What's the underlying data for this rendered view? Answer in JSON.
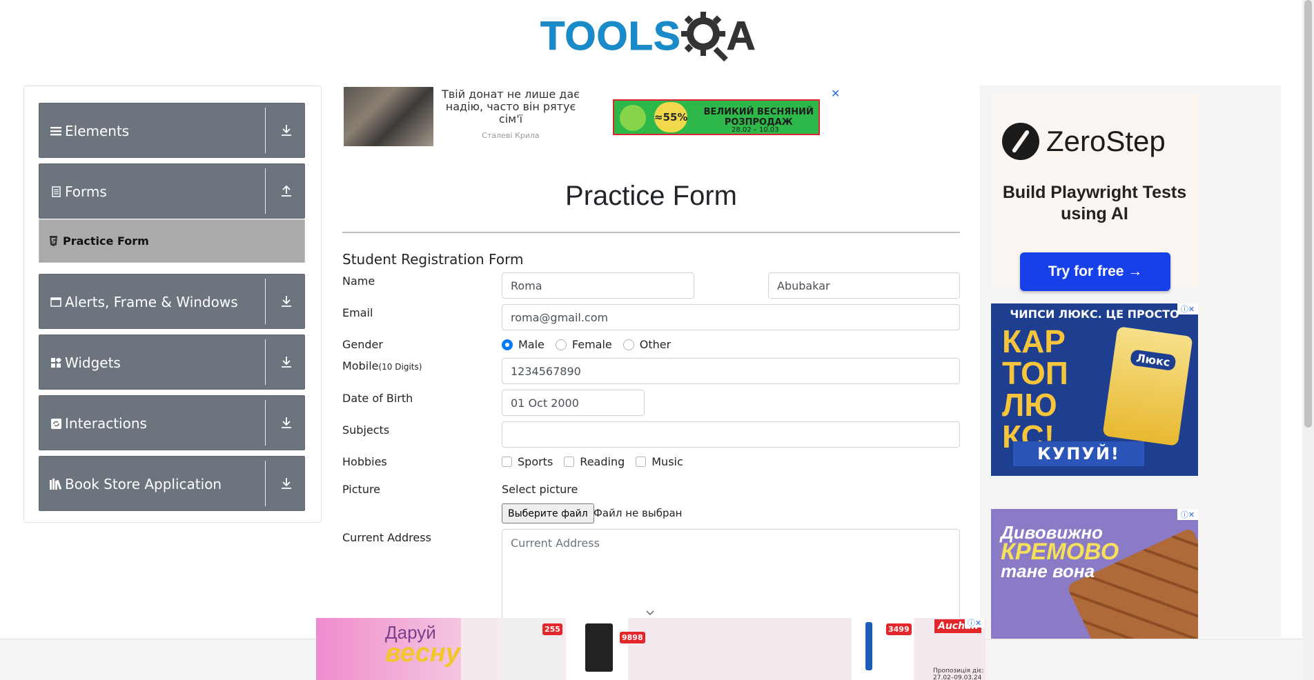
{
  "logo": {
    "text": "TOOLS",
    "letter_after_gear": "A"
  },
  "menu": {
    "groups": [
      {
        "label": "Elements",
        "icon": "hamburger-icon",
        "state": "collapsed"
      },
      {
        "label": "Forms",
        "icon": "document-icon",
        "state": "expanded"
      },
      {
        "label": "Alerts, Frame & Windows",
        "icon": "window-icon",
        "state": "collapsed"
      },
      {
        "label": "Widgets",
        "icon": "grid-icon",
        "state": "collapsed"
      },
      {
        "label": "Interactions",
        "icon": "refresh-icon",
        "state": "collapsed"
      },
      {
        "label": "Book Store Application",
        "icon": "books-icon",
        "state": "collapsed"
      }
    ],
    "active_item": "Practice Form"
  },
  "top_ad": {
    "text": "Твій донат не лише дає надію, часто він рятує сім'ї",
    "source": "Сталеві Крила",
    "badge": "≈55%",
    "banner_text": "ВЕЛИКИЙ ВЕСНЯНИЙ РОЗПРОДАЖ",
    "banner_date": "28.02 – 10.03",
    "close": "✕"
  },
  "form": {
    "page_title": "Practice Form",
    "title": "Student Registration Form",
    "name_label": "Name",
    "first_name": "Roma",
    "last_name": "Abubakar",
    "email_label": "Email",
    "email": "roma@gmail.com",
    "gender_label": "Gender",
    "genders": [
      "Male",
      "Female",
      "Other"
    ],
    "selected_gender": "Male",
    "mobile_label": "Mobile",
    "mobile_hint": "(10 Digits)",
    "mobile": "1234567890",
    "dob_label": "Date of Birth",
    "dob": "01 Oct 2000",
    "subjects_label": "Subjects",
    "subjects": "",
    "hobbies_label": "Hobbies",
    "hobbies": [
      "Sports",
      "Reading",
      "Music"
    ],
    "picture_label": "Picture",
    "select_picture": "Select picture",
    "file_button": "Выберите файл",
    "file_status": "Файл не выбран",
    "address_label": "Current Address",
    "address_placeholder": "Current Address"
  },
  "right_ads": {
    "zerostep": {
      "name": "ZeroStep",
      "tagline": "Build Playwright Tests using AI",
      "button": "Try for free →"
    },
    "chips": {
      "top": "ЧИПСИ ЛЮКС. ЦЕ ПРОСТО",
      "big": "КАР ТОП ЛЮ КС!",
      "pack": "Люкс",
      "buy": "КУПУЙ!"
    },
    "milka": {
      "line1": "Дивовижно",
      "line2": "КРЕМОВО",
      "line3": "тане вона"
    }
  },
  "bottom_ad": {
    "text_top": "Даруй",
    "text_big": "весну",
    "price1": "255",
    "price2": "9898",
    "price3": "3499",
    "store": "Auchan",
    "promo": "Пропозиція діє: 27.02–09.03.24"
  },
  "colors": {
    "menu_bg": "#6c757d",
    "active_item_bg": "#aaaaaa",
    "brand_blue": "#1a8ac9",
    "primary": "#007bff",
    "zerostep_btn": "#1740e8"
  }
}
